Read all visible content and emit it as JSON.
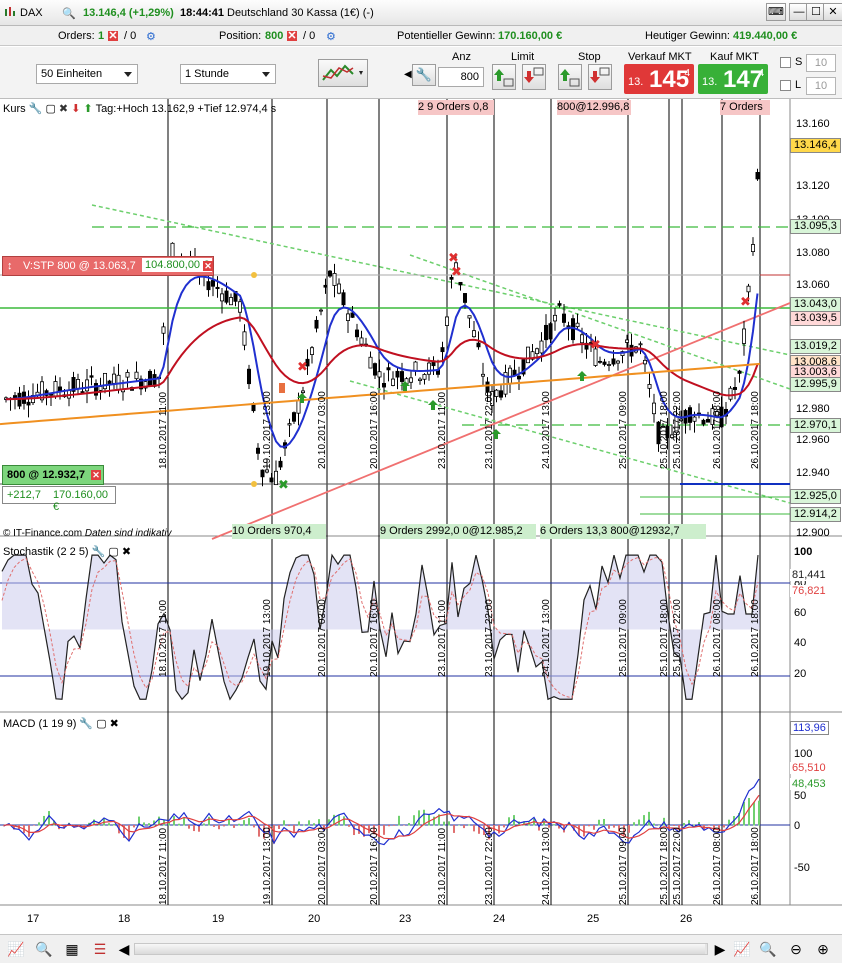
{
  "titlebar": {
    "symbol": "DAX",
    "change": "13.146,4 (+1,29%)",
    "time": "18:44:41",
    "instrument": "Deutschland 30 Kassa (1€) (-)"
  },
  "status": {
    "orders_label": "Orders:",
    "orders_value": "1",
    "orders_suffix": "/ 0",
    "position_label": "Position:",
    "position_value": "800",
    "position_suffix": "/ 0",
    "pot_gain_label": "Potentieller Gewinn:",
    "pot_gain_value": "170.160,00 €",
    "today_gain_label": "Heutiger Gewinn:",
    "today_gain_value": "419.440,00 €"
  },
  "toolbar": {
    "units_select": "50 Einheiten",
    "interval_select": "1 Stunde",
    "anz_label": "Anz",
    "anz_value": "800",
    "limit_label": "Limit",
    "stop_label": "Stop",
    "sell_label": "Verkauf MKT",
    "buy_label": "Kauf MKT",
    "sell_prefix": "13.",
    "sell_big": "145",
    "sell_sup": "4",
    "buy_prefix": "13.",
    "buy_big": "147",
    "buy_sup": "4",
    "s_label": "S",
    "s_value": "10",
    "l_label": "L",
    "l_value": "10"
  },
  "price_panel": {
    "title": "Kurs",
    "info": "Tag:+Hoch 13.162,9 +Tief 12.974,4 s",
    "copyright": "© IT-Finance.com",
    "disclaimer": "Daten sind indikativ",
    "stop_order_label": "V:STP 800 @ 13.063,7",
    "stop_order_value": "104.800,00 €",
    "position_label": "800 @ 12.932,7",
    "position_pts": "+212,7",
    "position_value": "170.160,00 €",
    "y_ticks": [
      "13.160",
      "13.140",
      "13.120",
      "13.100",
      "13.080",
      "13.060",
      "13.040",
      "13.020",
      "13.000",
      "12.980",
      "12.960",
      "12.940",
      "12.920",
      "12.900"
    ],
    "price_tags": [
      {
        "text": "13.146,4",
        "color": "#ffd84a"
      },
      {
        "text": "13.095,3",
        "color": "#d8f5d8"
      },
      {
        "text": "13.043,0",
        "color": "#d8f5d8"
      },
      {
        "text": "13.039,5",
        "color": "#ffd8d8"
      },
      {
        "text": "13.019,2",
        "color": "#d8f5d8"
      },
      {
        "text": "13.008,6",
        "color": "#ffe3c8"
      },
      {
        "text": "13.003,6",
        "color": "#ffd8d8"
      },
      {
        "text": "12.995,9",
        "color": "#d8f5d8"
      },
      {
        "text": "12.970,1",
        "color": "#d8f5d8"
      },
      {
        "text": "12.925,0",
        "color": "#d8f5d8"
      },
      {
        "text": "12.914,2",
        "color": "#d8f5d8"
      }
    ],
    "order_labels_top": [
      "2 9 Orders 0,8",
      "800@12.996,8",
      "7 Orders"
    ],
    "order_labels_bottom": [
      "10 Orders 970,4",
      "9 Orders 2992,0 0@12.985,2",
      "6 Orders 13,3 800@12932,7"
    ]
  },
  "stoch_panel": {
    "title": "Stochastik (2 2 5)",
    "y_ticks": [
      "100",
      "80",
      "60",
      "40",
      "20"
    ],
    "val1": "81,441",
    "val2": "76,821"
  },
  "macd_panel": {
    "title": "MACD (1 19 9)",
    "y_ticks": [
      "100",
      "50",
      "0",
      "-50"
    ],
    "val1": "113,96",
    "val2": "65,510",
    "val3": "48,453"
  },
  "vlines_dates": [
    "18.10.2017 11:00",
    "19.10.2017 13:00",
    "20.10.2017 03:00",
    "20.10.2017 16:00",
    "23.10.2017 11:00",
    "23.10.2017 22:00",
    "24.10.2017 13:00",
    "25.10.2017 09:00",
    "25.10.2017 18:00",
    "25.10.2017 22:00",
    "26.10.2017 08:00",
    "26.10.2017 18:00"
  ],
  "x_axis": [
    "17",
    "18",
    "19",
    "20",
    "23",
    "24",
    "25",
    "26"
  ],
  "colors": {
    "buy": "#3bb33b",
    "sell": "#e03c3c",
    "ma_red": "#c01020",
    "ma_blue": "#2030d0",
    "ma_orange": "#f09020"
  }
}
